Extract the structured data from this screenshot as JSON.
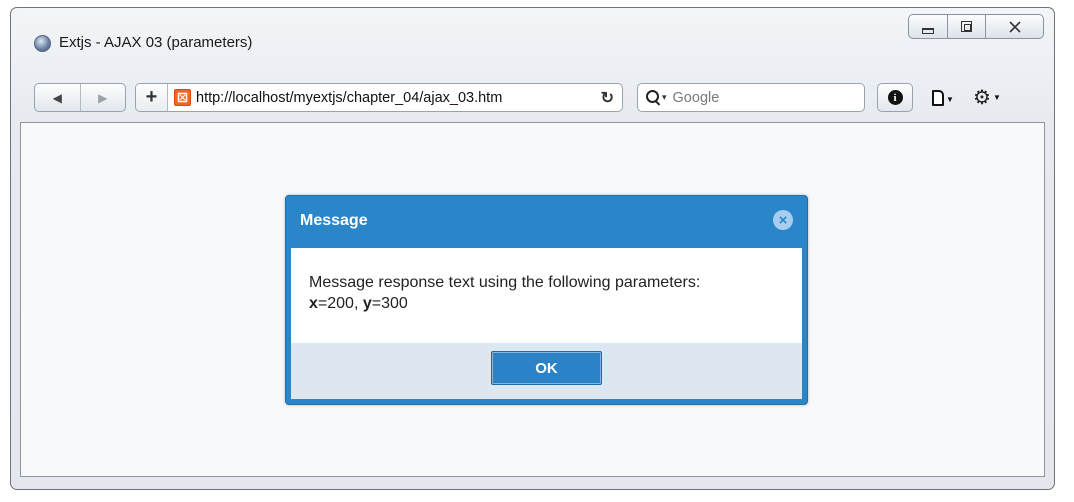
{
  "window": {
    "title": "Extjs - AJAX 03 (parameters)"
  },
  "toolbar": {
    "back_glyph": "◀",
    "forward_glyph": "▶",
    "add_glyph": "+",
    "url": "http://localhost/myextjs/chapter_04/ajax_03.htm",
    "reload_glyph": "↻",
    "search_placeholder": "Google",
    "info_glyph": "i"
  },
  "dialog": {
    "title": "Message",
    "close_glyph": "×",
    "message_line1": "Message response text using the following parameters:",
    "param_x_name": "x",
    "param_x_value": "=200, ",
    "param_y_name": "y",
    "param_y_value": "=300",
    "ok_label": "OK"
  },
  "colors": {
    "dialog_header": "#2b86c9",
    "dialog_footer": "#dde7f1",
    "content_bg": "#f8f9fa",
    "favicon": "#f26522"
  },
  "icons": [
    "app-globe-icon",
    "minimize-icon",
    "maximize-icon",
    "close-icon",
    "back-arrow-icon",
    "forward-arrow-icon",
    "add-bookmark-icon",
    "site-favicon-icon",
    "reload-icon",
    "search-icon",
    "info-icon",
    "page-icon",
    "gear-icon",
    "dialog-close-icon"
  ]
}
